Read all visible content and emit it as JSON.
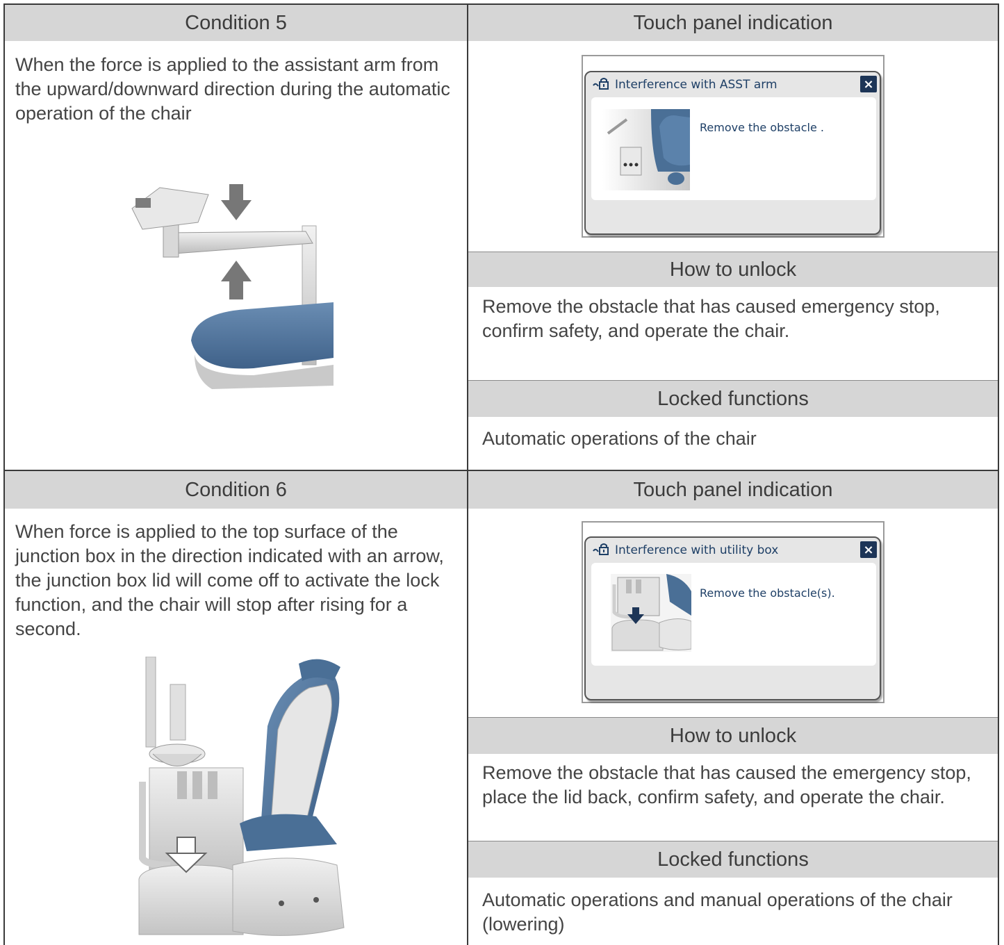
{
  "condition5": {
    "header": "Condition 5",
    "description": "When the force is applied to the assistant arm from the upward/downward direction during the automatic operation of the chair",
    "touch_header": "Touch panel indication",
    "panel": {
      "title": "Interference with ASST arm",
      "message": "Remove the obstacle .",
      "close_label": "×",
      "icon": "lock-hand-icon"
    },
    "unlock_header": "How to unlock",
    "unlock_text": "Remove the obstacle that has caused emergency stop, confirm safety, and operate the chair.",
    "locked_header": "Locked functions",
    "locked_text": "Automatic operations of the chair"
  },
  "condition6": {
    "header": "Condition 6",
    "description": "When force is applied to the top surface of the junction box in the direction indicated with an arrow, the junction box lid will come off to activate the lock function, and the chair will stop after rising for a second.",
    "touch_header": "Touch panel indication",
    "panel": {
      "title": "Interference with utility box",
      "message": "Remove the obstacle(s).",
      "close_label": "×",
      "icon": "lock-hand-icon"
    },
    "unlock_header": "How to unlock",
    "unlock_text": "Remove the obstacle that has caused the emergency stop, place the lid back, confirm safety, and operate the chair.",
    "locked_header": "Locked functions",
    "locked_text": "Automatic operations and manual operations of the chair (lowering)"
  },
  "colors": {
    "header_bg": "#d6d6d6",
    "chair_blue": "#4a6f96",
    "panel_navy": "#1d3557"
  }
}
